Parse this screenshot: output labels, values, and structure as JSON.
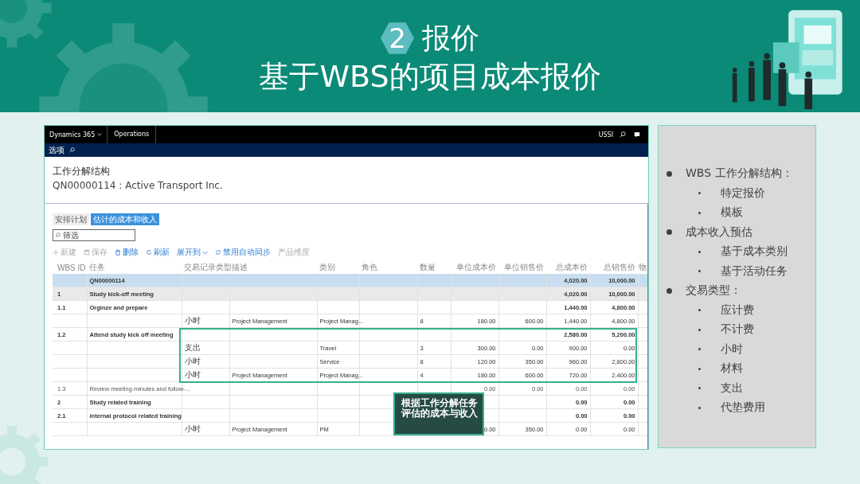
{
  "slide": {
    "number": "2",
    "title": "报价",
    "subtitle": "基于WBS的项目成本报价"
  },
  "app": {
    "nav": {
      "brand": "Dynamics 365",
      "module": "Operations",
      "user": "USSI"
    },
    "action_bar": {
      "label": "选项"
    },
    "page_title": "工作分解结构",
    "record": "QN00000114 : Active Transport Inc.",
    "tabs": [
      {
        "label": "安排计划",
        "selected": false
      },
      {
        "label": "估计的成本和收入",
        "selected": true
      }
    ],
    "filter": {
      "placeholder": "筛选"
    },
    "toolbar": [
      {
        "kind": "plus",
        "label": "新建",
        "disabled": true
      },
      {
        "kind": "save",
        "label": "保存",
        "disabled": true
      },
      {
        "kind": "delete",
        "label": "删除",
        "disabled": false
      },
      {
        "kind": "refresh",
        "label": "刷新",
        "disabled": false
      },
      {
        "kind": "dropdown",
        "label": "展开到",
        "disabled": false
      },
      {
        "kind": "sync",
        "label": "禁用自动同步",
        "disabled": false
      },
      {
        "kind": "text",
        "label": "产品维度",
        "disabled": true
      }
    ],
    "table": {
      "columns": [
        "WBS ID",
        "任务",
        "交易记录类型",
        "描述",
        "类别",
        "角色",
        "数量",
        "单位成本价",
        "单位销售价",
        "总成本价",
        "总销售价",
        "物"
      ],
      "rows": [
        {
          "kind": "root",
          "cells": [
            null,
            "QN00000114",
            null,
            null,
            null,
            null,
            null,
            null,
            null,
            "4,020.00",
            "10,000.00",
            null
          ]
        },
        {
          "kind": "summary",
          "cells": [
            "1",
            "Study kick-off meeting",
            null,
            null,
            null,
            null,
            null,
            null,
            null,
            "4,020.00",
            "10,000.00",
            null
          ]
        },
        {
          "kind": "task",
          "cells": [
            "1.1",
            "Orginze and prepare",
            null,
            null,
            null,
            null,
            null,
            null,
            null,
            "1,440.00",
            "4,800.00",
            null
          ]
        },
        {
          "kind": "line",
          "cells": [
            null,
            null,
            "小时",
            "Project Management",
            "Project Manag...",
            null,
            "8",
            "180.00",
            "600.00",
            "1,440.00",
            "4,800.00",
            null
          ]
        },
        {
          "kind": "task",
          "cells": [
            "1.2",
            "Attend study kick off meeting",
            null,
            null,
            null,
            null,
            null,
            null,
            null,
            "2,580.00",
            "5,200.00",
            null
          ]
        },
        {
          "kind": "line",
          "cells": [
            null,
            null,
            "支出",
            null,
            "Travel",
            null,
            "3",
            "300.00",
            "0.00",
            "900.00",
            "0.00",
            null
          ]
        },
        {
          "kind": "line",
          "cells": [
            null,
            null,
            "小时",
            null,
            "Service",
            null,
            "8",
            "120.00",
            "350.00",
            "960.00",
            "2,800.00",
            null
          ]
        },
        {
          "kind": "line",
          "cells": [
            null,
            null,
            "小时",
            "Project Management",
            "Project Manag...",
            null,
            "4",
            "180.00",
            "600.00",
            "720.00",
            "2,400.00",
            null
          ]
        },
        {
          "kind": "plain",
          "cells": [
            "1.3",
            "Review meeting minutes and follow-...",
            null,
            null,
            null,
            null,
            null,
            "0.00",
            "0.00",
            "0.00",
            "0.00",
            null
          ]
        },
        {
          "kind": "task",
          "cells": [
            "2",
            "Study related training",
            null,
            null,
            null,
            null,
            null,
            null,
            null,
            "0.00",
            "0.00",
            null
          ]
        },
        {
          "kind": "task",
          "cells": [
            "2.1",
            "internal protocol related training",
            null,
            null,
            null,
            null,
            null,
            null,
            null,
            "0.00",
            "0.00",
            null
          ]
        },
        {
          "kind": "line",
          "cells": [
            null,
            null,
            "小时",
            "Project Management",
            "PM",
            null,
            null,
            "0.00",
            "350.00",
            "0.00",
            "0.00",
            null
          ]
        }
      ]
    }
  },
  "callout": "根据工作分解任务评估的成本与收入",
  "bullets": [
    {
      "text": "WBS 工作分解结构：",
      "children": [
        {
          "text": "特定报价"
        },
        {
          "text": "模板"
        }
      ]
    },
    {
      "text": "成本收入预估",
      "children": [
        {
          "text": "基于成本类别"
        },
        {
          "text": "基于活动任务"
        }
      ]
    },
    {
      "text": "交易类型：",
      "children": [
        {
          "text": "应计费"
        },
        {
          "text": "不计费"
        },
        {
          "text": "小时"
        },
        {
          "text": "材料"
        },
        {
          "text": "支出"
        },
        {
          "text": "代垫费用"
        }
      ]
    }
  ]
}
